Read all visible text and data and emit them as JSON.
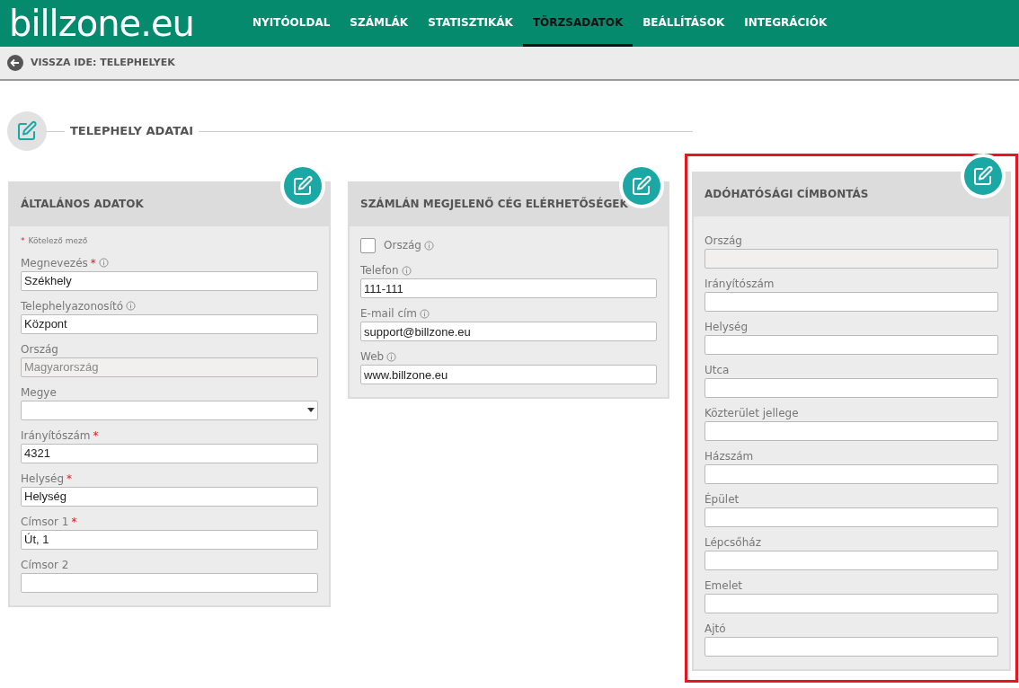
{
  "logo": "billzone.eu",
  "nav": [
    {
      "label": "NYITÓOLDAL",
      "selected": false
    },
    {
      "label": "SZÁMLÁK",
      "selected": false
    },
    {
      "label": "STATISZTIKÁK",
      "selected": false
    },
    {
      "label": "TÖRZSADATOK",
      "selected": true
    },
    {
      "label": "BEÁLLÍTÁSOK",
      "selected": false
    },
    {
      "label": "INTEGRÁCIÓK",
      "selected": false
    }
  ],
  "back_link": "VISSZA IDE: TELEPHELYEK",
  "section_title": "TELEPHELY ADATAI",
  "panels": [
    {
      "title": "ÁLTALÁNOS ADATOK",
      "highlighted": false,
      "required_note_mark": "*",
      "required_note": "Kötelező mező",
      "fields": [
        {
          "kind": "text",
          "label": "Megnevezés",
          "required_mark": "*",
          "info": true,
          "value": "Székhely"
        },
        {
          "kind": "text",
          "label": "Telephelyazonosító",
          "required": false,
          "info": true,
          "value": "Központ"
        },
        {
          "kind": "text",
          "label": "Ország",
          "required": false,
          "info": false,
          "value": "Magyarország",
          "disabled": true
        },
        {
          "kind": "select",
          "label": "Megye",
          "required": false,
          "info": false
        },
        {
          "kind": "text",
          "label": "Irányítószám",
          "required_mark": "*",
          "info": false,
          "value": "4321"
        },
        {
          "kind": "text",
          "label": "Helység",
          "required_mark": "*",
          "info": false,
          "value": "Helység"
        },
        {
          "kind": "text",
          "label": "Címsor 1",
          "required_mark": "*",
          "info": false,
          "value": "Út, 1"
        },
        {
          "kind": "text",
          "label": "Címsor 2",
          "required": false,
          "info": false
        }
      ]
    },
    {
      "title": "SZÁMLÁN MEGJELENŐ CÉG ELÉRHETŐSÉGEK",
      "highlighted": false,
      "fields": [
        {
          "kind": "checkbox",
          "label": "Ország",
          "info": true,
          "checked": false
        },
        {
          "kind": "text",
          "label": "Telefon",
          "required": false,
          "info": true,
          "value": "111-111"
        },
        {
          "kind": "text",
          "label": "E-mail cím",
          "required": false,
          "info": true,
          "value": "support@billzone.eu"
        },
        {
          "kind": "text",
          "label": "Web",
          "required": false,
          "info": true,
          "value": "www.billzone.eu"
        }
      ]
    },
    {
      "title": "ADÓHATÓSÁGI CÍMBONTÁS",
      "highlighted": true,
      "fields": [
        {
          "kind": "text",
          "label": "Ország",
          "required": false,
          "info": false,
          "disabled": true
        },
        {
          "kind": "text",
          "label": "Irányítószám",
          "required": false,
          "info": false
        },
        {
          "kind": "text",
          "label": "Helység",
          "required": false,
          "info": false
        },
        {
          "kind": "text",
          "label": "Utca",
          "required": false,
          "info": false
        },
        {
          "kind": "text",
          "label": "Közterület jellege",
          "required": false,
          "info": false
        },
        {
          "kind": "text",
          "label": "Házszám",
          "required": false,
          "info": false
        },
        {
          "kind": "text",
          "label": "Épület",
          "required": false,
          "info": false
        },
        {
          "kind": "text",
          "label": "Lépcsőház",
          "required": false,
          "info": false
        },
        {
          "kind": "text",
          "label": "Emelet",
          "required": false,
          "info": false
        },
        {
          "kind": "text",
          "label": "Ajtó",
          "required": false,
          "info": false
        }
      ]
    }
  ]
}
